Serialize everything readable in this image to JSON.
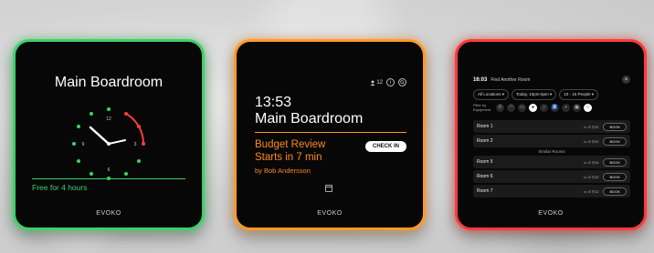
{
  "brand": "EVOKO",
  "left": {
    "room": "Main Boardroom",
    "status": "Free for 4 hours",
    "clock_numbers": [
      "12",
      "3",
      "6",
      "9"
    ],
    "accent": "#3fd06a",
    "busy_color": "#ff3b3b"
  },
  "middle": {
    "capacity": "12",
    "info_icon": "info-icon",
    "search_icon": "search-icon",
    "time": "13:53",
    "room": "Main Boardroom",
    "meeting_line1": "Budget Review",
    "meeting_line2": "Starts in 7 min",
    "organizer": "by Bob Andersson",
    "checkin_label": "CHECK IN",
    "accent": "#ff9a2a"
  },
  "right": {
    "time": "16:03",
    "title": "Find Another Room",
    "filters": [
      "All Locations",
      "Today, 10pm-5pm",
      "10 - 15 People"
    ],
    "equipment_label": "Filter by Equipment",
    "equipment_icons": [
      "phone-icon",
      "wifi-icon",
      "screen-icon",
      "camera-icon",
      "mic-icon",
      "accessibility-icon",
      "projector-icon",
      "display-icon",
      "whiteboard-icon"
    ],
    "rooms": [
      {
        "name": "Room 1",
        "meta": "12",
        "book": "BOOK"
      },
      {
        "name": "Room 2",
        "meta": "12",
        "book": "BOOK"
      }
    ],
    "similar_label": "Similar Rooms",
    "similar_rooms": [
      {
        "name": "Room 5",
        "meta": "14",
        "book": "BOOK"
      },
      {
        "name": "Room 6",
        "meta": "12",
        "book": "BOOK"
      },
      {
        "name": "Room 7",
        "meta": "12",
        "book": "BOOK"
      }
    ],
    "accent": "#ff3b3b"
  }
}
